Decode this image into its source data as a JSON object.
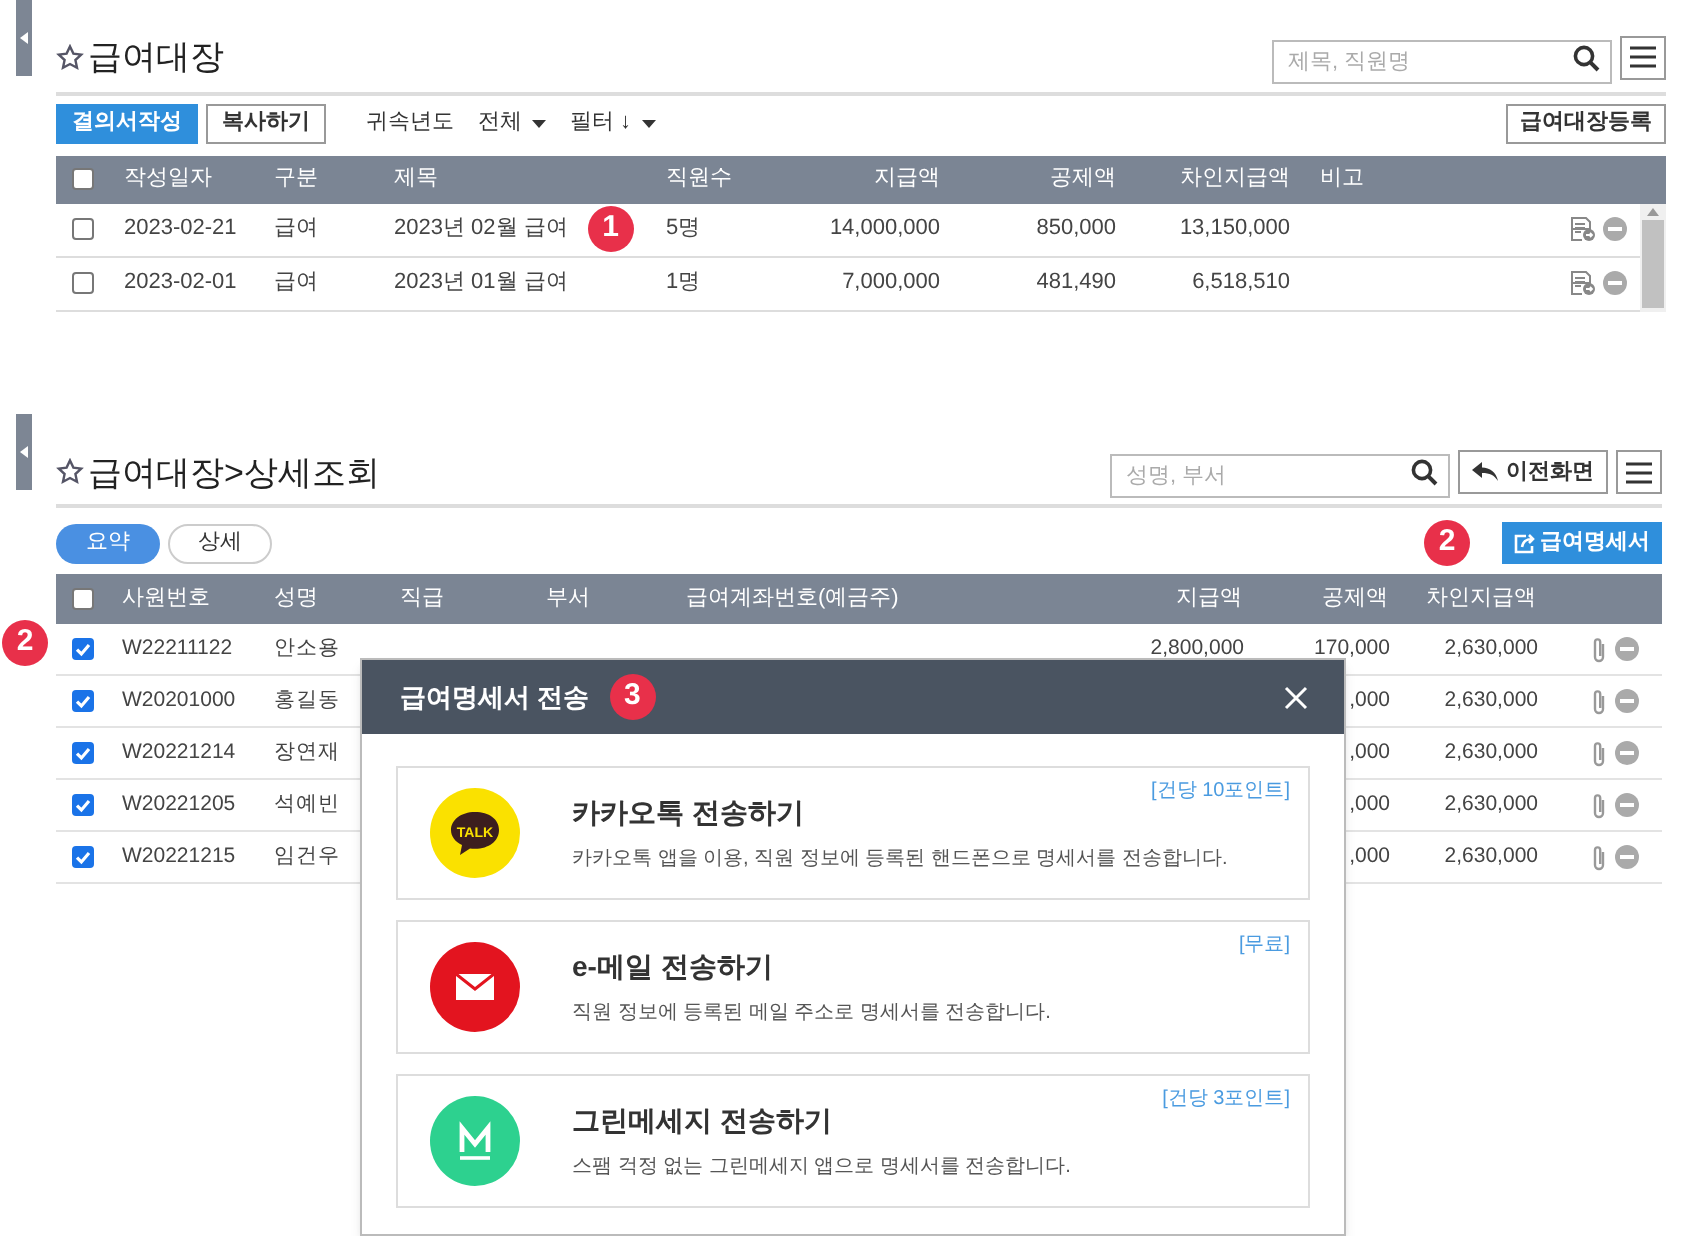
{
  "payroll_ledger": {
    "title": "급여대장",
    "search": {
      "placeholder": "제목, 직원명"
    },
    "toolbar": {
      "buttons": [
        {
          "label": "결의서작성",
          "kind": "primary"
        },
        {
          "label": "복사하기",
          "kind": "default"
        }
      ],
      "filters": [
        {
          "label": "귀속년도",
          "kind": "label"
        },
        {
          "label": "전체",
          "kind": "dropdown"
        },
        {
          "label": "필터 ↓",
          "kind": "dropdown"
        }
      ],
      "register_button": "급여대장등록"
    },
    "table": {
      "select_all_checked": false,
      "columns": [
        "작성일자",
        "구분",
        "제목",
        "직원수",
        "지급액",
        "공제액",
        "차인지급액",
        "비고"
      ],
      "rows": [
        {
          "checked": false,
          "date": "2023-02-21",
          "type": "급여",
          "title": "2023년 02월 급여",
          "marker": "1",
          "staff": "5명",
          "pay": "14,000,000",
          "deduction": "850,000",
          "net": "13,150,000"
        },
        {
          "checked": false,
          "date": "2023-02-01",
          "type": "급여",
          "title": "2023년 01월 급여",
          "staff": "1명",
          "pay": "7,000,000",
          "deduction": "481,490",
          "net": "6,518,510"
        }
      ]
    }
  },
  "detail_view": {
    "title": "급여대장>상세조회",
    "search": {
      "placeholder": "성명, 부서"
    },
    "back_button": "이전화면",
    "view_toggle": [
      {
        "label": "요약",
        "selected": true
      },
      {
        "label": "상세",
        "selected": false
      }
    ],
    "payslip_button": {
      "label": "급여명세서",
      "marker": "2"
    },
    "table": {
      "select_all_checked": false,
      "columns": [
        "사원번호",
        "성명",
        "직급",
        "부서",
        "급여계좌번호(예금주)",
        "지급액",
        "공제액",
        "차인지급액"
      ],
      "marker": "2",
      "rows": [
        {
          "checked": true,
          "employee_no": "W22211122",
          "name": "안소용",
          "pay": "2,800,000",
          "deduction": "170,000",
          "net": "2,630,000"
        },
        {
          "checked": true,
          "employee_no": "W20201000",
          "name": "홍길동",
          "deduction": ",000",
          "net": "2,630,000"
        },
        {
          "checked": true,
          "employee_no": "W20221214",
          "name": "장연재",
          "deduction": ",000",
          "net": "2,630,000"
        },
        {
          "checked": true,
          "employee_no": "W20221205",
          "name": "석예빈",
          "deduction": ",000",
          "net": "2,630,000"
        },
        {
          "checked": true,
          "employee_no": "W20221215",
          "name": "임건우",
          "deduction": ",000",
          "net": "2,630,000"
        }
      ]
    }
  },
  "send_dialog": {
    "title": "급여명세서 전송",
    "marker": "3",
    "options": [
      {
        "kind": "kakao",
        "icon_text": "TALK",
        "title": "카카오톡 전송하기",
        "price": "[건당 10포인트]",
        "description": "카카오톡 앱을 이용, 직원 정보에 등록된 핸드폰으로 명세서를 전송합니다."
      },
      {
        "kind": "email",
        "title": "e-메일 전송하기",
        "price": "[무료]",
        "description": "직원 정보에 등록된 메일 주소로 명세서를 전송합니다."
      },
      {
        "kind": "green",
        "title": "그린메세지 전송하기",
        "price": "[건당 3포인트]",
        "description": "스팸 걱정 없는 그린메세지 앱으로 명세서를 전송합니다."
      }
    ]
  }
}
